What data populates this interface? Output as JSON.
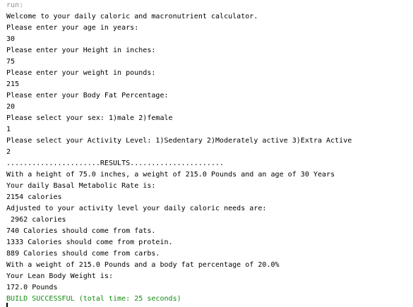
{
  "console": {
    "run_label": "run:",
    "lines": [
      "Welcome to your daily caloric and macronutrient calculator.",
      "Please enter your age in years:",
      "30",
      "Please enter your Height in inches:",
      "75",
      "Please enter your weight in pounds:",
      "215",
      "Please enter your Body Fat Percentage:",
      "20",
      "Please select your sex: 1)male 2)female",
      "1",
      "Please select your Activity Level: 1)Sedentary 2)Moderately active 3)Extra Active",
      "2",
      "......................RESULTS......................",
      "With a height of 75.0 inches, a weight of 215.0 Pounds and an age of 30 Years",
      "Your daily Basal Metabolic Rate is:",
      "2154 calories",
      "Adjusted to your activity level your daily caloric needs are:",
      " 2962 calories",
      "740 Calories should come from fats.",
      "1333 Calories should come from protein.",
      "889 Calories should come from carbs.",
      "With a weight of 215.0 Pounds and a body fat percentage of 20.0%",
      "Your Lean Body Weight is:",
      "172.0 Pounds"
    ],
    "build_status": "BUILD SUCCESSFUL (total time: 25 seconds)"
  },
  "colors": {
    "background": "#ffffff",
    "text": "#000000",
    "run_label": "#8c8c8c",
    "success": "#108a10"
  }
}
